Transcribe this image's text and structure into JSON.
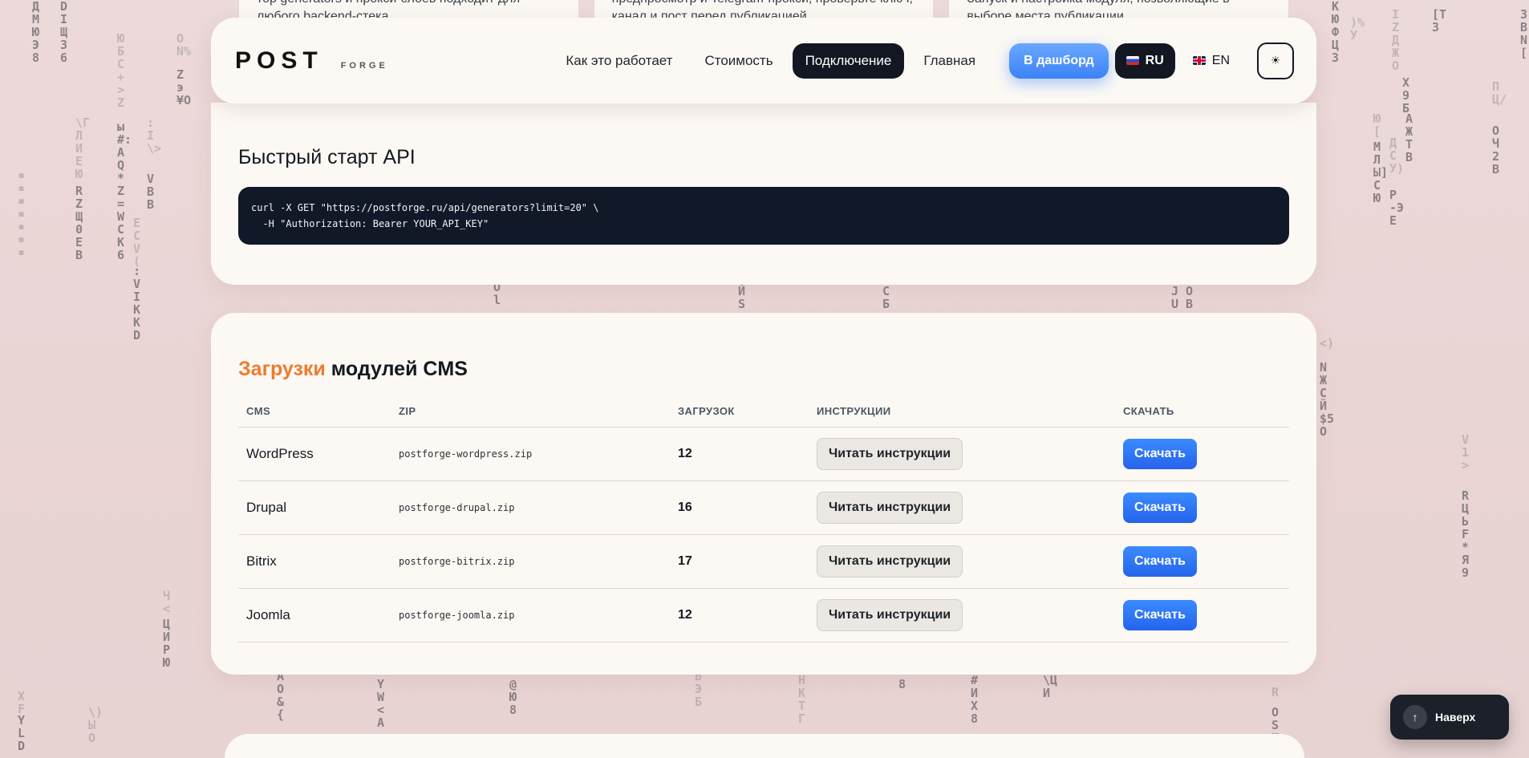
{
  "top_cards": [
    {
      "text": "тор generators и прокси-слоев подходит для любого backend-стека"
    },
    {
      "text": "предпросмотр и Telegram-прокси, проверьте ключ, канал и пост перед публикацией"
    },
    {
      "text": "Запуск и настройка модуля, позволяющие в выборе места публикации"
    }
  ],
  "header": {
    "logo_main": "POST",
    "logo_sub": "FORGE",
    "nav": [
      "Как это работает",
      "Стоимость",
      "Подключение",
      "Главная"
    ],
    "active_nav": "Подключение",
    "dashboard_label": "В дашборд",
    "lang_ru": "RU",
    "lang_en": "EN",
    "theme_icon": "☀"
  },
  "api": {
    "title": "Быстрый старт API",
    "code_line1": "curl -X GET \"https://postforge.ru/api/generators?limit=20\" \\",
    "code_line2": "  -H \"Authorization: Bearer YOUR_API_KEY\""
  },
  "cms": {
    "title_accent": "Загрузки",
    "title_rest": " модулей CMS",
    "columns": [
      "CMS",
      "ZIP",
      "ЗАГРУЗОК",
      "ИНСТРУКЦИИ",
      "СКАЧАТЬ"
    ],
    "rows": [
      {
        "name": "WordPress",
        "zip": "postforge-wordpress.zip",
        "count": "12",
        "read": "Читать инструкции",
        "download": "Скачать"
      },
      {
        "name": "Drupal",
        "zip": "postforge-drupal.zip",
        "count": "16",
        "read": "Читать инструкции",
        "download": "Скачать"
      },
      {
        "name": "Bitrix",
        "zip": "postforge-bitrix.zip",
        "count": "17",
        "read": "Читать инструкции",
        "download": "Скачать"
      },
      {
        "name": "Joomla",
        "zip": "postforge-joomla.zip",
        "count": "12",
        "read": "Читать инструкции",
        "download": "Скачать"
      }
    ]
  },
  "scroll_top": {
    "label": "Наверх",
    "icon": "↑"
  },
  "colors": {
    "accent": "#f07b2e",
    "primary": "#3b82f6",
    "dark": "#121722"
  }
}
